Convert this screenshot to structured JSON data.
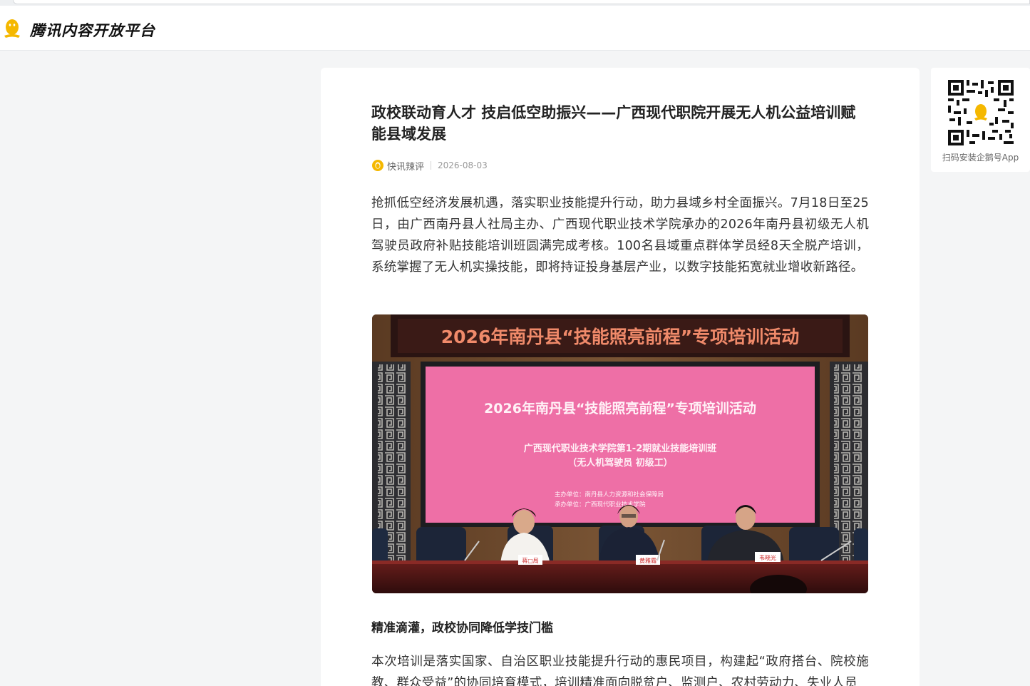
{
  "header": {
    "brand": "腾讯内容开放平台",
    "logo_icon": "penguin-logo-icon"
  },
  "article": {
    "title": "政校联动育人才 技启低空助振兴——广西现代职院开展无人机公益培训赋能县域发展",
    "source": "快讯辣评",
    "date": "2026-08-03",
    "paragraph1": "抢抓低空经济发展机遇，落实职业技能提升行动，助力县域乡村全面振兴。7月18日至25日，由广西南丹县人社局主办、广西现代职业技术学院承办的2026年南丹县初级无人机驾驶员政府补贴技能培训班圆满完成考核。100名县域重点群体学员经8天全脱产培训，系统掌握了无人机实操技能，即将持证投身基层产业，以数字技能拓宽就业增收新路径。",
    "photo": {
      "banner": "2026年南丹县“技能照亮前程”专项培训活动",
      "screen_title": "2026年南丹县“技能照亮前程”专项培训活动",
      "screen_line1": "广西现代职业技术学院第1-2期就业技能培训班",
      "screen_line2": "（无人机驾驶员 初级工）",
      "screen_org1": "主办单位：南丹县人力资源和社会保障局",
      "screen_org2": "承办单位：广西现代职业技术学院",
      "nameplates": [
        "蒋□局",
        "黄雅霜",
        "韦晓光"
      ]
    },
    "subheading": "精准滴灌，政校协同降低学技门槛",
    "paragraph2": "本次培训是落实国家、自治区职业技能提升行动的惠民项目，构建起“政府搭台、院校施教、群众受益”的协同培育模式，培训精准面向脱贫户、监测户、农村劳动力、失业人员"
  },
  "sidebar": {
    "qr_caption": "扫码安装企鹅号App",
    "qr_icon": "qr-code-icon"
  },
  "colors": {
    "accent": "#f5b800",
    "background": "#f4f5f6",
    "screen_pink": "#ee6fa6"
  }
}
